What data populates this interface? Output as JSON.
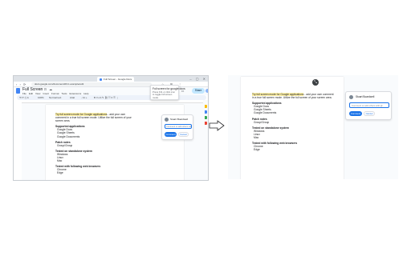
{
  "browser": {
    "tab_title": "Full Screen - Google Docs",
    "url": "docs.google.com/document/d/1z-example/edit",
    "window_controls": "– ▢ ✕",
    "nav_icons": "‹ › ⟳",
    "ext_icons": "☆ ⊞ ⋮"
  },
  "doc": {
    "title": "Full Screen",
    "star_icons": "☆ ⊡ ☁",
    "menus": [
      "File",
      "Edit",
      "View",
      "Insert",
      "Format",
      "Tools",
      "Extensions",
      "Help"
    ],
    "share_label": "Share",
    "header_icons": "◷ ▭",
    "tooltip": {
      "title": "Full screen for google docs",
      "body": "Press F11 or click icon to toggle full screen mode."
    },
    "toolbar": {
      "undo": "⟲ ⟳ ⎙ A",
      "zoom": "100%",
      "style": "Normal text",
      "font": "Arial",
      "size": "- 11 +",
      "format": "B I U A ✎ ⛓ ☷ ≡ ☰ ⋮"
    }
  },
  "content": {
    "intro_highlight": "Try full screen mode for Google applications",
    "intro_rest": " - add your own comment in a true full screen mode. Utilize the full screen of your screen area.",
    "sections": [
      {
        "heading": "Supported applications",
        "items": [
          "Google Docs",
          "Google Sheets",
          "Google Documents"
        ]
      },
      {
        "heading": "Patch notes",
        "items": [
          "Group/Group"
        ]
      },
      {
        "heading": "Tested on standalone system",
        "items": [
          "Windows",
          "Linux",
          "Mac"
        ]
      },
      {
        "heading": "Tested with following web browsers",
        "items": [
          "Chrome",
          "Edge"
        ]
      }
    ]
  },
  "comment": {
    "author": "Stuart Boardwell",
    "placeholder": "Comment or add others with @",
    "comment_button": "Comment",
    "cancel_button": "Cancel"
  },
  "fullscreen": {
    "exit_icon": "⤡"
  },
  "colors": {
    "accent": "#1a73e8",
    "highlight": "#fff2a8",
    "share_bg": "#c2e7ff"
  }
}
